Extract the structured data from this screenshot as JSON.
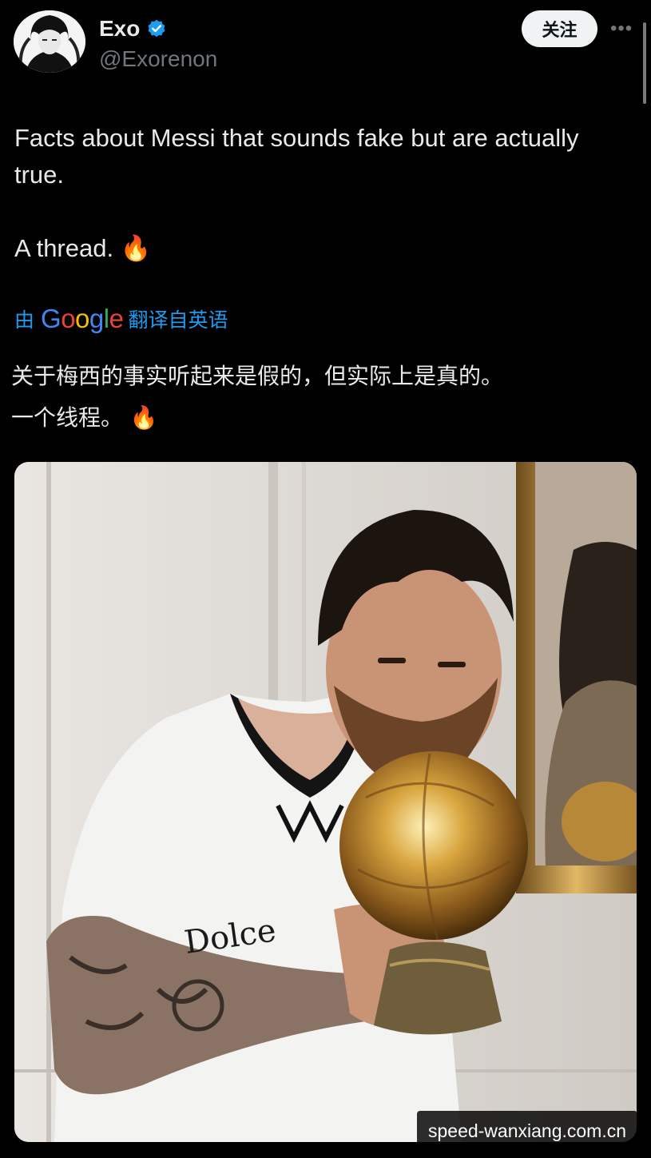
{
  "author": {
    "display_name": "Exo",
    "handle": "@Exorenon",
    "verified_icon": "verified-badge-icon",
    "avatar_icon": "avatar-icon"
  },
  "follow_label": "关注",
  "more_icon": "more-options-icon",
  "tweet": {
    "line1": "Facts about Messi that sounds fake but are actually true.",
    "line2": "A thread. 🔥"
  },
  "translation": {
    "prefix": "由",
    "provider": "Google",
    "suffix": "翻译自英语",
    "text_line1": "关于梅西的事实听起来是假的，但实际上是真的。",
    "text_line2": "一个线程。 🔥"
  },
  "media": {
    "subject": "photo-icon"
  },
  "watermark": "speed-wanxiang.com.cn",
  "colors": {
    "background": "#000000",
    "text": "#e7e9ea",
    "secondary_text": "#71767b",
    "link": "#1d9bf0",
    "verified": "#1d9bf0"
  }
}
